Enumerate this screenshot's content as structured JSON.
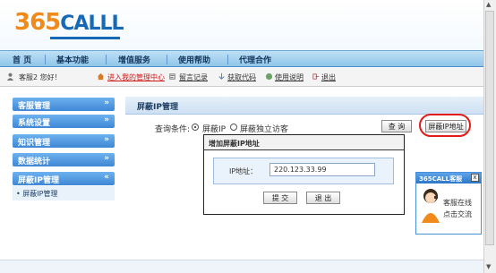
{
  "logo": {
    "numbers": "365",
    "word": "CALLL"
  },
  "nav": {
    "items": [
      "首 页",
      "基本功能",
      "增值服务",
      "使用帮助",
      "代理合作"
    ]
  },
  "userbar": {
    "greeting": "客服2 您好！",
    "links": [
      "进入我的管理中心",
      "留言记录",
      "获取代码",
      "使用说明",
      "退出"
    ]
  },
  "sidebar": {
    "items": [
      "客服管理",
      "系统设置",
      "知识管理",
      "数据统计",
      "屏蔽IP管理"
    ],
    "sub_item": "• 屏蔽IP管理"
  },
  "panel": {
    "title": "屏蔽IP管理",
    "query_label": "查询条件:",
    "radio_ip": "屏蔽IP",
    "radio_visitor": "屏蔽独立访客",
    "search_btn": "查 询",
    "block_btn": "屏蔽IP地址"
  },
  "dialog": {
    "title": "增加屏蔽IP地址",
    "ip_label": "IP地址：",
    "ip_value": "220.123.33.99",
    "submit": "提 交",
    "exit": "退 出"
  },
  "widget": {
    "title": "365CALL客服",
    "close": "x",
    "line1": "客服在线",
    "line2": "点击交流"
  },
  "colors": {
    "nav_bg": "#a7d3f1",
    "sidebar": "#4a91dc",
    "highlight": "#e21a1a",
    "link_red": "#d01818"
  }
}
